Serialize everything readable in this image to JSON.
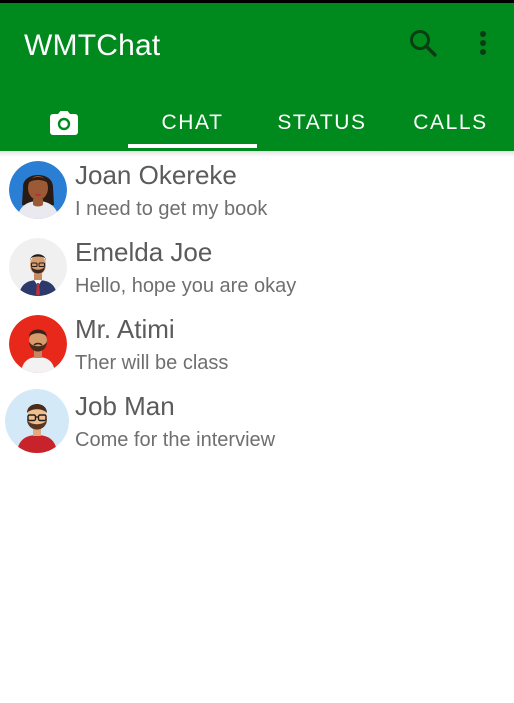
{
  "app": {
    "title": "WMTChat"
  },
  "header": {
    "icons": [
      "search-icon",
      "more-vert-icon"
    ],
    "color": "#008a1e"
  },
  "tabs": [
    {
      "icon": "camera-icon",
      "label": ""
    },
    {
      "label": "CHAT",
      "selected": true
    },
    {
      "label": "STATUS"
    },
    {
      "label": "CALLS"
    }
  ],
  "chats": [
    {
      "name": "Joan Okereke",
      "message": "I need to get my book"
    },
    {
      "name": "Emelda Joe",
      "message": "Hello, hope you are okay"
    },
    {
      "name": "Mr. Atimi",
      "message": "Ther will be class"
    },
    {
      "name": "Job Man",
      "message": "Come for the interview"
    }
  ]
}
